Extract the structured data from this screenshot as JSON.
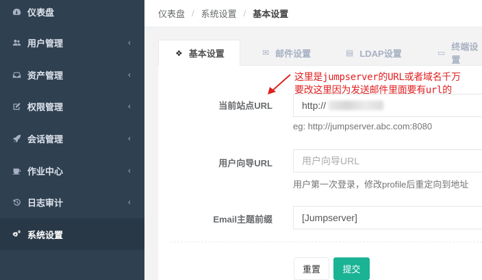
{
  "sidebar": {
    "items": [
      {
        "label": "仪表盘",
        "icon": "dashboard-icon",
        "has_chevron": false
      },
      {
        "label": "用户管理",
        "icon": "users-icon",
        "has_chevron": true
      },
      {
        "label": "资产管理",
        "icon": "inbox-icon",
        "has_chevron": true
      },
      {
        "label": "权限管理",
        "icon": "edit-icon",
        "has_chevron": true
      },
      {
        "label": "会话管理",
        "icon": "rocket-icon",
        "has_chevron": true
      },
      {
        "label": "作业中心",
        "icon": "coffee-icon",
        "has_chevron": true
      },
      {
        "label": "日志审计",
        "icon": "history-icon",
        "has_chevron": true
      },
      {
        "label": "系统设置",
        "icon": "cogs-icon",
        "has_chevron": false,
        "active": true
      }
    ],
    "chevron": "‹"
  },
  "breadcrumb": {
    "items": [
      "仪表盘",
      "系统设置",
      "基本设置"
    ],
    "separator": "/"
  },
  "tabs": [
    {
      "label": "基本设置",
      "icon": "cubes-icon",
      "active": true
    },
    {
      "label": "邮件设置",
      "icon": "envelope-icon"
    },
    {
      "label": "LDAP设置",
      "icon": "database-icon"
    },
    {
      "label": "终端设置",
      "icon": "hdd-icon"
    }
  ],
  "form": {
    "site_url": {
      "label": "当前站点URL",
      "value": "http://",
      "help": "eg: http://jumpserver.abc.com:8080"
    },
    "user_guide_url": {
      "label": "用户向导URL",
      "placeholder": "用户向导URL",
      "help": "用户第一次登录，修改profile后重定向到地址"
    },
    "email_prefix": {
      "label": "Email主题前缀",
      "value": "[Jumpserver]"
    },
    "reset_label": "重置",
    "submit_label": "提交"
  },
  "annotation": {
    "line1": "这里是jumpserver的URL或者域名千万",
    "line2": "要改这里因为发送邮件里面要有url的"
  },
  "colors": {
    "sidebar_bg": "#2f4050",
    "sidebar_active": "#293846",
    "primary": "#1ab394",
    "annotation": "#e02020"
  }
}
